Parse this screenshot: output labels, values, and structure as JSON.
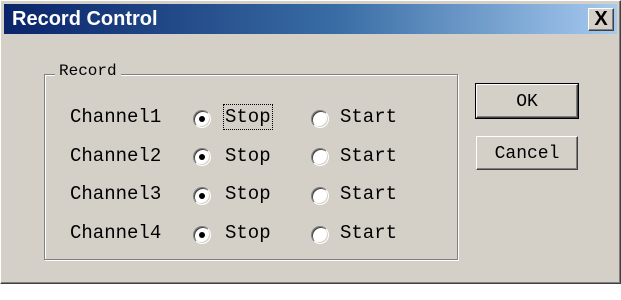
{
  "window": {
    "title": "Record Control",
    "close_glyph": "X"
  },
  "group": {
    "label": "Record"
  },
  "channels": [
    {
      "label": "Channel1",
      "stop_label": "Stop",
      "start_label": "Start",
      "selected": "Stop"
    },
    {
      "label": "Channel2",
      "stop_label": "Stop",
      "start_label": "Start",
      "selected": "Stop"
    },
    {
      "label": "Channel3",
      "stop_label": "Stop",
      "start_label": "Start",
      "selected": "Stop"
    },
    {
      "label": "Channel4",
      "stop_label": "Stop",
      "start_label": "Start",
      "selected": "Stop"
    }
  ],
  "buttons": {
    "ok_label": "OK",
    "cancel_label": "Cancel"
  },
  "colors": {
    "dialog_face": "#d4d0c8",
    "title_gradient_start": "#0a246a",
    "title_gradient_end": "#a6caf0",
    "title_text": "#ffffff"
  }
}
